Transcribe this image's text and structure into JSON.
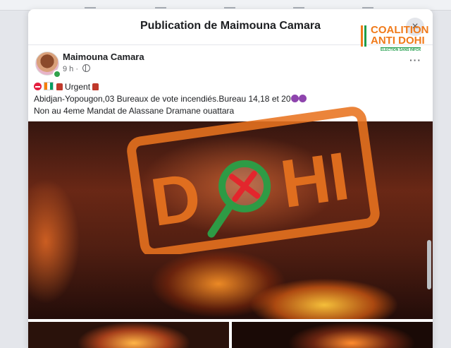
{
  "modal": {
    "title": "Publication de Maimouna Camara",
    "close_label": "×",
    "more_label": "···"
  },
  "post": {
    "author": "Maimouna Camara",
    "time": "9 h ·",
    "urgent_label": " Urgent ",
    "line2_text": "Abidjan-Yopougon,03 Bureaux de vote incendiés.Bureau 14,18 et 20",
    "line3_text": "Non au 4eme Mandat de Alassane Dramane ouattara"
  },
  "watermark": {
    "stamp_text_left": "D",
    "stamp_text_right": "HI",
    "logo_line1": "COALITION",
    "logo_line2": "ANTI DOHI",
    "logo_sub": "ELECTION SANS INFOX"
  },
  "icons": [
    "close-icon",
    "globe-icon",
    "more-icon",
    "search-cross-icon"
  ],
  "colors": {
    "stamp_orange": "#e8731f",
    "stamp_green": "#2e9b45",
    "stamp_red": "#e3262d"
  }
}
